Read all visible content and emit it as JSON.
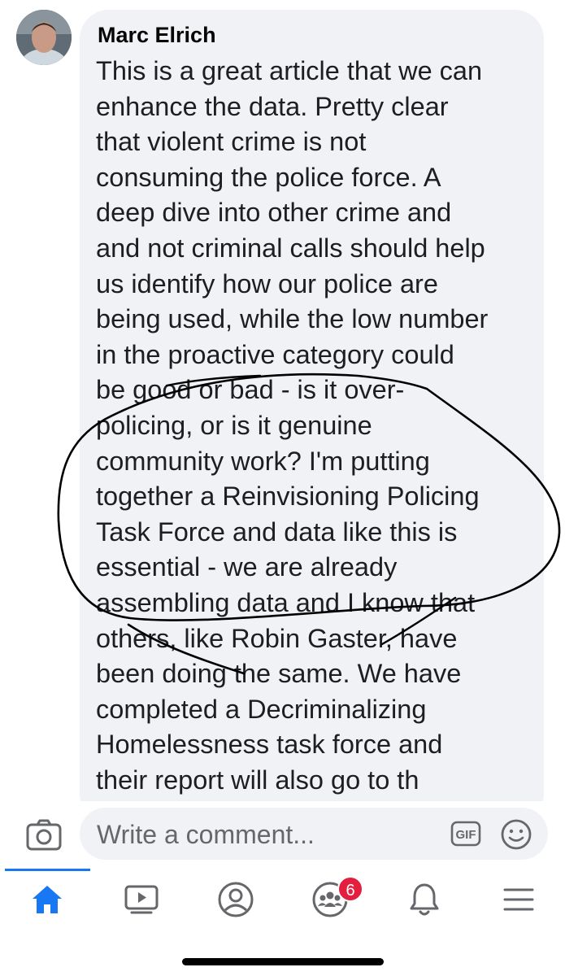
{
  "comment": {
    "author": "Marc Elrich",
    "lines": [
      "This is a great article that we can",
      "enhance the data.  Pretty clear",
      "that violent crime is not",
      "consuming the police force.  A",
      "deep dive into other crime and",
      "and not criminal calls should help",
      "us identify how our police are",
      "being used, while the low number",
      "in the proactive category could",
      "be good or bad - is it over-",
      "policing, or is it genuine",
      "community work? I'm putting",
      "together a Reinvisioning Policing",
      "Task Force and data like this is",
      "essential - we are already",
      "assembling data and I know that",
      "others, like Robin Gaster, have",
      "been doing the same.  We have",
      "completed a Decriminalizing",
      "Homelessness task force and",
      "their report will also go to th"
    ]
  },
  "composer": {
    "placeholder": "Write a comment...",
    "gif_label": "GIF",
    "camera_icon": "camera-icon",
    "emoji_icon": "emoji-icon"
  },
  "tabbar": {
    "tabs": [
      {
        "name": "home",
        "icon": "home-icon",
        "active": true
      },
      {
        "name": "watch",
        "icon": "video-icon"
      },
      {
        "name": "profile",
        "icon": "profile-icon"
      },
      {
        "name": "groups",
        "icon": "groups-icon",
        "badge": "6"
      },
      {
        "name": "notifications",
        "icon": "bell-icon"
      },
      {
        "name": "menu",
        "icon": "menu-icon"
      }
    ]
  },
  "colors": {
    "accent": "#1877f2",
    "badge": "#e41e3f",
    "bubble": "#f0f2f5",
    "ink": "#000000"
  }
}
